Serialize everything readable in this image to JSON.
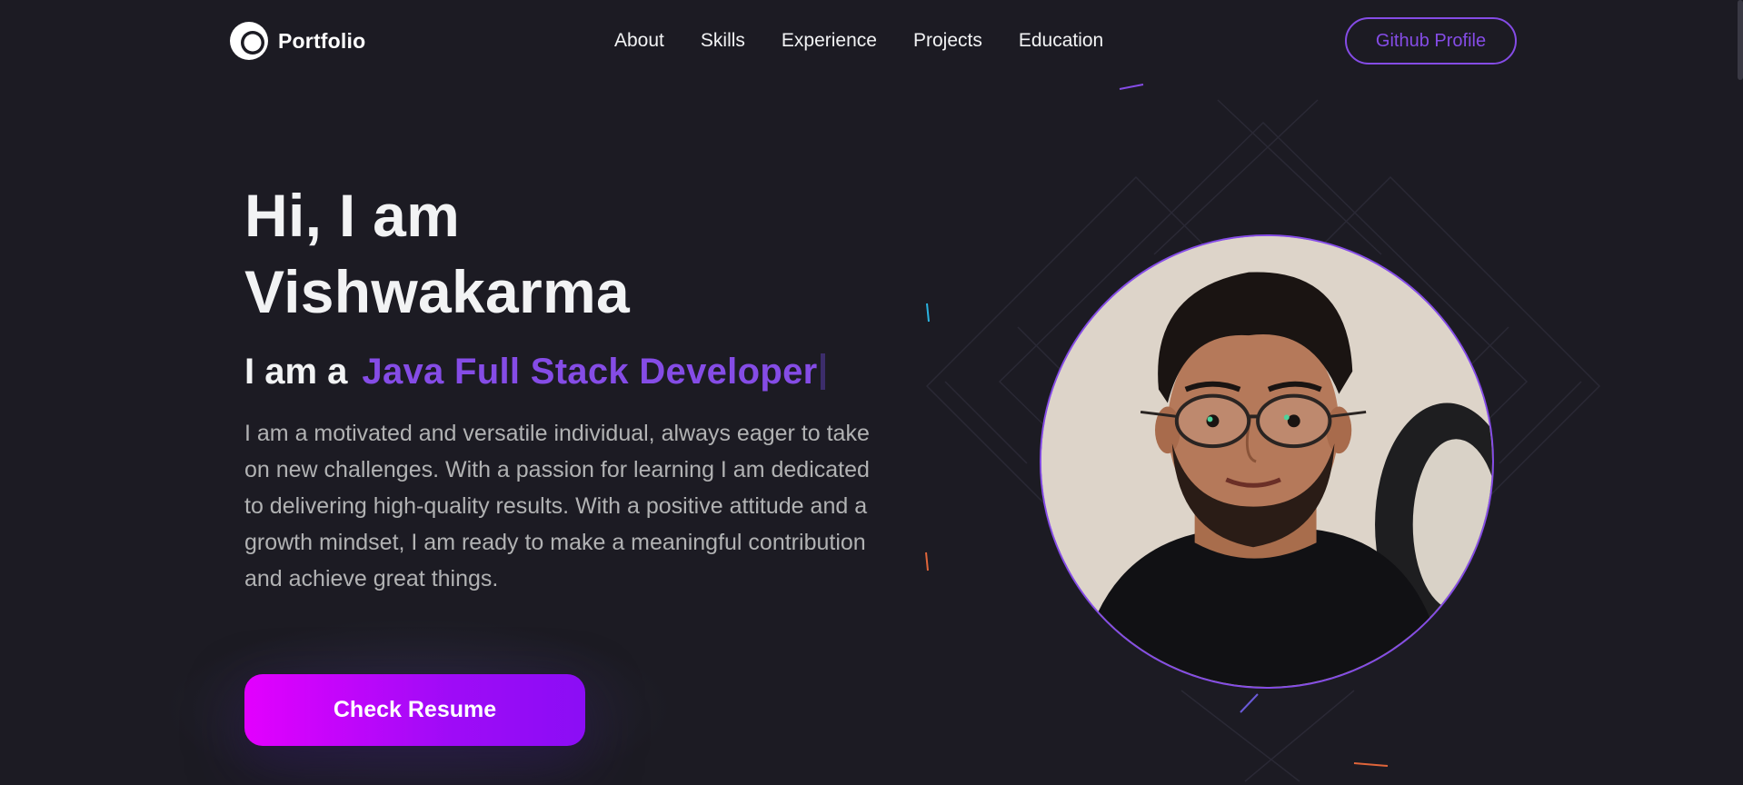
{
  "nav": {
    "logo_text": "Portfolio",
    "links": [
      "About",
      "Skills",
      "Experience",
      "Projects",
      "Education"
    ],
    "github_button": "Github Profile"
  },
  "hero": {
    "title_line1": "Hi, I am",
    "title_line2": "Vishwakarma",
    "role_prefix": "I am a",
    "role_value": "Java Full Stack Developer",
    "description": "I am a motivated and versatile individual, always eager to take on new challenges. With a passion for learning I am dedicated to delivering high-quality results. With a positive attitude and a growth mindset, I am ready to make a meaningful contribution and achieve great things.",
    "resume_button": "Check Resume"
  },
  "colors": {
    "background": "#1c1b23",
    "primary": "#854ce6",
    "text_primary": "#f2f3f4",
    "text_secondary": "#b1b2b3",
    "button_gradient_start": "#e300fe",
    "button_gradient_end": "#8b0df5"
  },
  "icons": {
    "logo": "crescent-circle-icon"
  }
}
